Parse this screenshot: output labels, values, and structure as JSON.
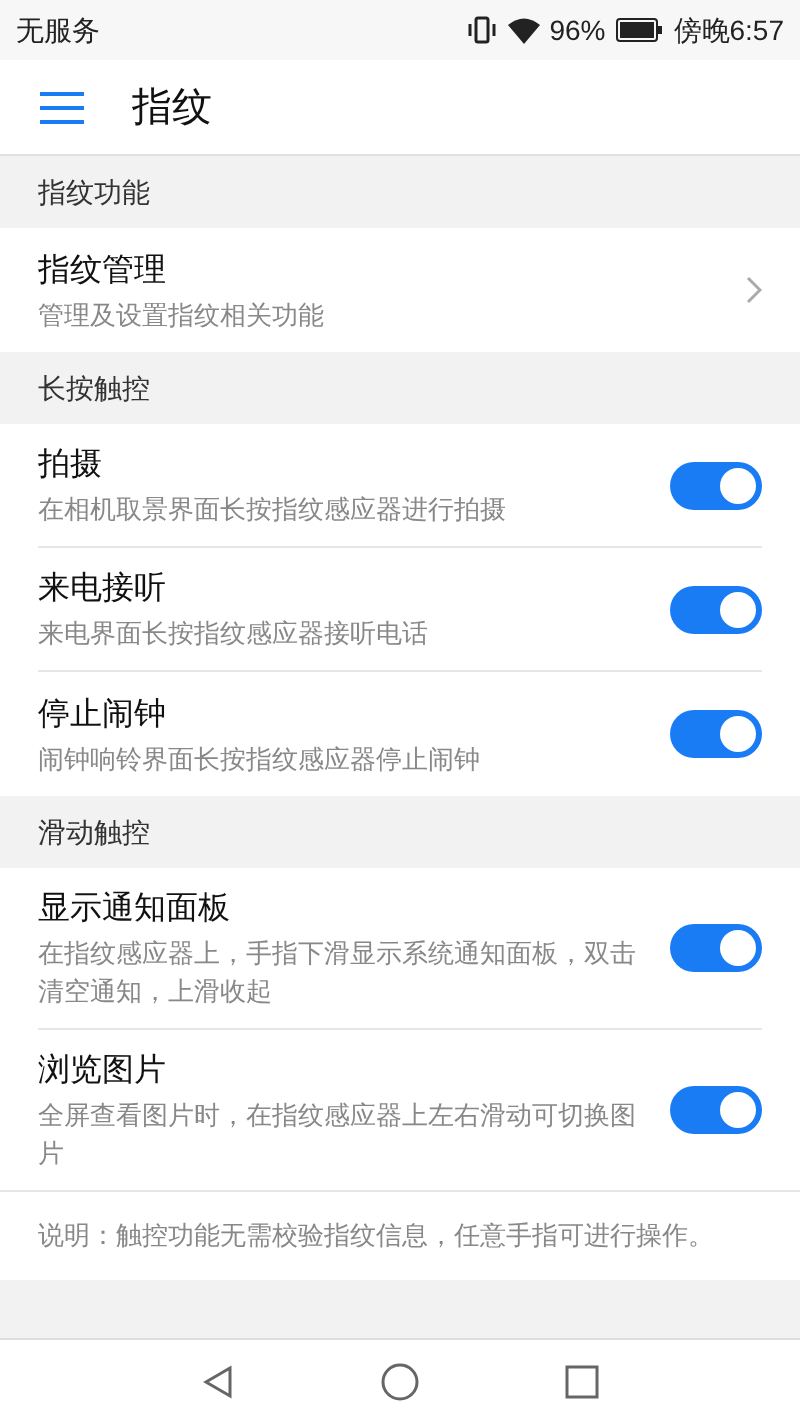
{
  "status_bar": {
    "carrier": "无服务",
    "battery": "96%",
    "time": "傍晚6:57"
  },
  "header": {
    "title": "指纹"
  },
  "sections": [
    {
      "title": "指纹功能",
      "items": [
        {
          "kind": "link",
          "title": "指纹管理",
          "subtitle": "管理及设置指纹相关功能"
        }
      ]
    },
    {
      "title": "长按触控",
      "items": [
        {
          "kind": "switch",
          "title": "拍摄",
          "subtitle": "在相机取景界面长按指纹感应器进行拍摄",
          "on": true
        },
        {
          "kind": "switch",
          "title": "来电接听",
          "subtitle": "来电界面长按指纹感应器接听电话",
          "on": true
        },
        {
          "kind": "switch",
          "title": "停止闹钟",
          "subtitle": "闹钟响铃界面长按指纹感应器停止闹钟",
          "on": true
        }
      ]
    },
    {
      "title": "滑动触控",
      "items": [
        {
          "kind": "switch",
          "title": "显示通知面板",
          "subtitle": "在指纹感应器上，手指下滑显示系统通知面板，双击清空通知，上滑收起",
          "on": true
        },
        {
          "kind": "switch",
          "title": "浏览图片",
          "subtitle": "全屏查看图片时，在指纹感应器上左右滑动可切换图片",
          "on": true
        }
      ]
    }
  ],
  "note": "说明：触控功能无需校验指纹信息，任意手指可进行操作。"
}
